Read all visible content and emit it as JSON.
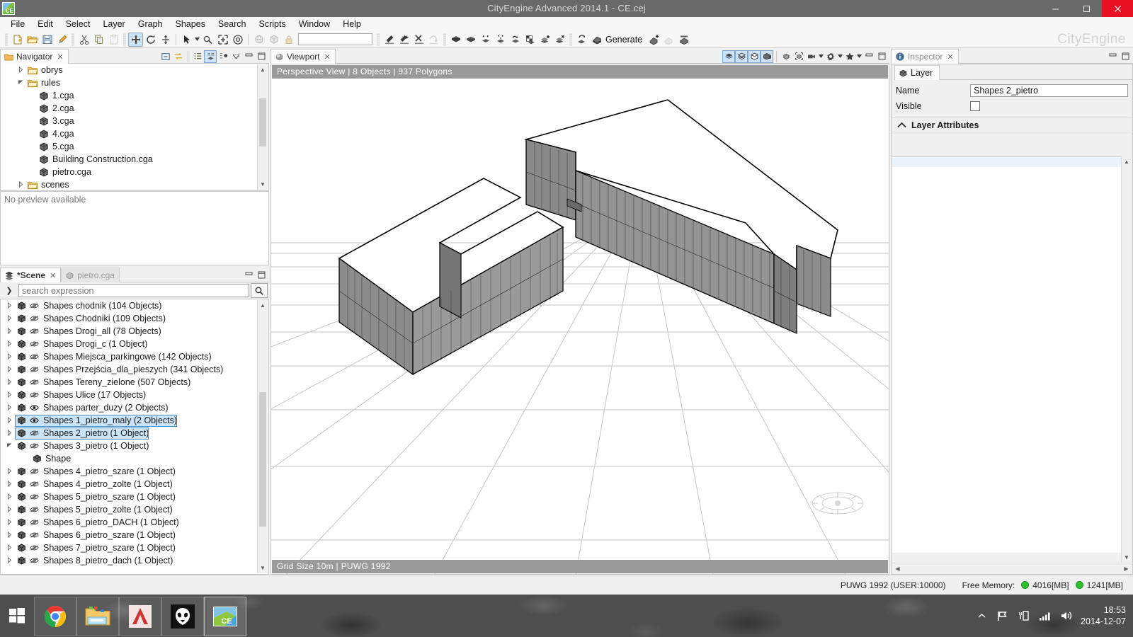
{
  "window": {
    "title": "CityEngine Advanced 2014.1 - CE.cej",
    "logo_text": "CE",
    "minimize": "–",
    "maximize": "❐",
    "close": "✕"
  },
  "menubar": {
    "items": [
      "File",
      "Edit",
      "Select",
      "Layer",
      "Graph",
      "Shapes",
      "Search",
      "Scripts",
      "Window",
      "Help"
    ]
  },
  "toolbar": {
    "search_value": "",
    "generate_label": "Generate",
    "brand": "CityEngine",
    "groups": [
      {
        "name": "file",
        "buttons": [
          "new-icon",
          "open-icon",
          "save-icon",
          "brush-icon"
        ]
      },
      {
        "name": "edit",
        "buttons": [
          "cut-icon",
          "copy-icon",
          "paste-icon"
        ]
      },
      {
        "name": "transform",
        "buttons": [
          "move-icon",
          "rotate-icon",
          "scale-icon"
        ]
      },
      {
        "name": "select",
        "buttons": [
          "pointer-icon",
          "pointer-dropdown-icon",
          "magic-select-icon",
          "select-all-icon",
          "select-object-icon"
        ]
      },
      {
        "name": "align",
        "buttons": [
          "globe-icon",
          "cube-icon",
          "lock-icon"
        ]
      },
      {
        "name": "street",
        "buttons": [
          "street-draw-icon",
          "street-add-icon",
          "street-cross-icon",
          "street-loop-icon"
        ]
      },
      {
        "name": "shapes",
        "buttons": [
          "shape-polygon-icon",
          "shape-box-icon",
          "shape-subdivide-icon",
          "shape-split-icon",
          "shape-cleanup-icon",
          "shape-texture-icon",
          "shape-add-icon",
          "shape-remove-icon"
        ]
      },
      {
        "name": "generate",
        "buttons": [
          "model-layer-icon",
          "generate-icon",
          "generate-add-icon",
          "generate-clear-icon",
          "generate-all-icon"
        ]
      }
    ]
  },
  "navigator": {
    "tab": "Navigator",
    "tab_close": "✕",
    "toolbar_icons": [
      "collapse-all-icon",
      "link-editor-icon",
      "view-menu-icon",
      "filter-icon",
      "layout-icon",
      "view-dropdown-icon",
      "minimize-icon",
      "maximize-icon"
    ],
    "items": [
      {
        "label": "obrys",
        "icon": "folder-icon",
        "indent": 1,
        "twist": "collapsed"
      },
      {
        "label": "rules",
        "icon": "folder-icon",
        "indent": 1,
        "twist": "expanded"
      },
      {
        "label": "1.cga",
        "icon": "cga-file-icon",
        "indent": 2,
        "twist": "none"
      },
      {
        "label": "2.cga",
        "icon": "cga-file-icon",
        "indent": 2,
        "twist": "none"
      },
      {
        "label": "3.cga",
        "icon": "cga-file-icon",
        "indent": 2,
        "twist": "none"
      },
      {
        "label": "4.cga",
        "icon": "cga-file-icon",
        "indent": 2,
        "twist": "none"
      },
      {
        "label": "5.cga",
        "icon": "cga-file-icon",
        "indent": 2,
        "twist": "none"
      },
      {
        "label": "Building Construction.cga",
        "icon": "cga-file-icon",
        "indent": 2,
        "twist": "none"
      },
      {
        "label": "pietro.cga",
        "icon": "cga-file-icon",
        "indent": 2,
        "twist": "none"
      },
      {
        "label": "scenes",
        "icon": "folder-icon",
        "indent": 1,
        "twist": "collapsed"
      }
    ]
  },
  "preview": {
    "message": "No preview available"
  },
  "scene": {
    "tabs": [
      {
        "label": "*Scene",
        "icon": "layers-icon",
        "active": true,
        "close": "✕"
      },
      {
        "label": "pietro.cga",
        "icon": "cga-file-icon",
        "active": false
      }
    ],
    "search": {
      "placeholder": "search expression",
      "value": "",
      "expand_icon": "chevron-right-icon",
      "search_icon": "search-icon"
    },
    "layers": [
      {
        "label": "Shapes chodnik (104 Objects)",
        "visible": false,
        "selected": false,
        "twist": "collapsed",
        "indent": 0
      },
      {
        "label": "Shapes Chodniki (109 Objects)",
        "visible": false,
        "selected": false,
        "twist": "collapsed",
        "indent": 0
      },
      {
        "label": "Shapes Drogi_all (78 Objects)",
        "visible": false,
        "selected": false,
        "twist": "collapsed",
        "indent": 0
      },
      {
        "label": "Shapes Drogi_c (1 Object)",
        "visible": false,
        "selected": false,
        "twist": "collapsed",
        "indent": 0
      },
      {
        "label": "Shapes Miejsca_parkingowe (142 Objects)",
        "visible": false,
        "selected": false,
        "twist": "collapsed",
        "indent": 0
      },
      {
        "label": "Shapes Przejścia_dla_pieszych (341 Objects)",
        "visible": false,
        "selected": false,
        "twist": "collapsed",
        "indent": 0
      },
      {
        "label": "Shapes Tereny_zielone (507 Objects)",
        "visible": false,
        "selected": false,
        "twist": "collapsed",
        "indent": 0
      },
      {
        "label": "Shapes Ulice (17 Objects)",
        "visible": false,
        "selected": false,
        "twist": "collapsed",
        "indent": 0
      },
      {
        "label": "Shapes parter_duzy (2 Objects)",
        "visible": true,
        "selected": false,
        "twist": "collapsed",
        "indent": 0
      },
      {
        "label": "Shapes 1_pietro_maly (2 Objects)",
        "visible": true,
        "selected": true,
        "twist": "collapsed",
        "indent": 0
      },
      {
        "label": "Shapes 2_pietro (1 Object)",
        "visible": false,
        "selected": true,
        "twist": "collapsed",
        "indent": 0
      },
      {
        "label": "Shapes 3_pietro (1 Object)",
        "visible": false,
        "selected": false,
        "twist": "expanded",
        "indent": 0
      },
      {
        "label": "Shape",
        "visible": null,
        "selected": false,
        "twist": "none",
        "indent": 1
      },
      {
        "label": "Shapes 4_pietro_szare (1 Object)",
        "visible": false,
        "selected": false,
        "twist": "collapsed",
        "indent": 0
      },
      {
        "label": "Shapes 4_pietro_zolte (1 Object)",
        "visible": false,
        "selected": false,
        "twist": "collapsed",
        "indent": 0
      },
      {
        "label": "Shapes 5_pietro_szare (1 Object)",
        "visible": false,
        "selected": false,
        "twist": "collapsed",
        "indent": 0
      },
      {
        "label": "Shapes 5_pietro_zolte (1 Object)",
        "visible": false,
        "selected": false,
        "twist": "collapsed",
        "indent": 0
      },
      {
        "label": "Shapes 6_pietro_DACH (1 Object)",
        "visible": false,
        "selected": false,
        "twist": "collapsed",
        "indent": 0
      },
      {
        "label": "Shapes 6_pietro_szare (1 Object)",
        "visible": false,
        "selected": false,
        "twist": "collapsed",
        "indent": 0
      },
      {
        "label": "Shapes 7_pietro_szare (1 Object)",
        "visible": false,
        "selected": false,
        "twist": "collapsed",
        "indent": 0
      },
      {
        "label": "Shapes 8_pietro_dach (1 Object)",
        "visible": false,
        "selected": false,
        "twist": "collapsed",
        "indent": 0
      }
    ]
  },
  "viewport": {
    "tab": "Viewport",
    "tab_close": "✕",
    "info": "Perspective View  |  8 Objects   |  937 Polygons",
    "status": "Grid Size 10m  |  PUWG 1992",
    "tools": [
      {
        "name": "shaded-icon",
        "active": true
      },
      {
        "name": "wireframe-icon",
        "active": true
      },
      {
        "name": "shapes-visible-icon",
        "active": true
      },
      {
        "name": "models-visible-icon",
        "active": true
      },
      {
        "name": "frame-selection-icon",
        "active": false
      },
      {
        "name": "frame-all-icon",
        "active": false
      },
      {
        "name": "camera-icon",
        "active": false
      },
      {
        "name": "camera-dropdown-icon",
        "active": false
      },
      {
        "name": "settings-gear-icon",
        "active": false
      },
      {
        "name": "settings-dropdown-icon",
        "active": false
      },
      {
        "name": "bookmark-star-icon",
        "active": false
      },
      {
        "name": "bookmark-dropdown-icon",
        "active": false
      },
      {
        "name": "minimize-icon",
        "active": false
      },
      {
        "name": "maximize-icon",
        "active": false
      }
    ],
    "compass_label": "navigation-compass"
  },
  "inspector": {
    "tab": "Inspector",
    "tab_close": "✕",
    "subtab": "Layer",
    "fields": [
      {
        "label": "Name",
        "value": "Shapes 2_pietro",
        "type": "text"
      },
      {
        "label": "Visible",
        "value": false,
        "type": "checkbox"
      }
    ],
    "section": {
      "title": "Layer Attributes",
      "collapse_icon": "chevron-up-icon"
    }
  },
  "statusbar": {
    "coordinate_system": "PUWG 1992 (USER:10000)",
    "free_memory_label": "Free Memory:",
    "memory": [
      {
        "value": "4016[MB]",
        "color": "#2fbf2f"
      },
      {
        "value": "1241[MB]",
        "color": "#2fbf2f"
      }
    ]
  },
  "taskbar": {
    "start": "windows-start-icon",
    "apps": [
      {
        "name": "chrome-icon",
        "running": false
      },
      {
        "name": "file-explorer-icon",
        "running": false
      },
      {
        "name": "autocad-icon",
        "running": false
      },
      {
        "name": "foobar2000-icon",
        "running": false
      },
      {
        "name": "cityengine-icon",
        "running": true
      }
    ],
    "tray": [
      "tray-expand-icon",
      "flag-icon",
      "action-center-icon",
      "network-icon",
      "volume-icon"
    ],
    "clock": {
      "time": "18:53",
      "date": "2014-12-07"
    }
  }
}
